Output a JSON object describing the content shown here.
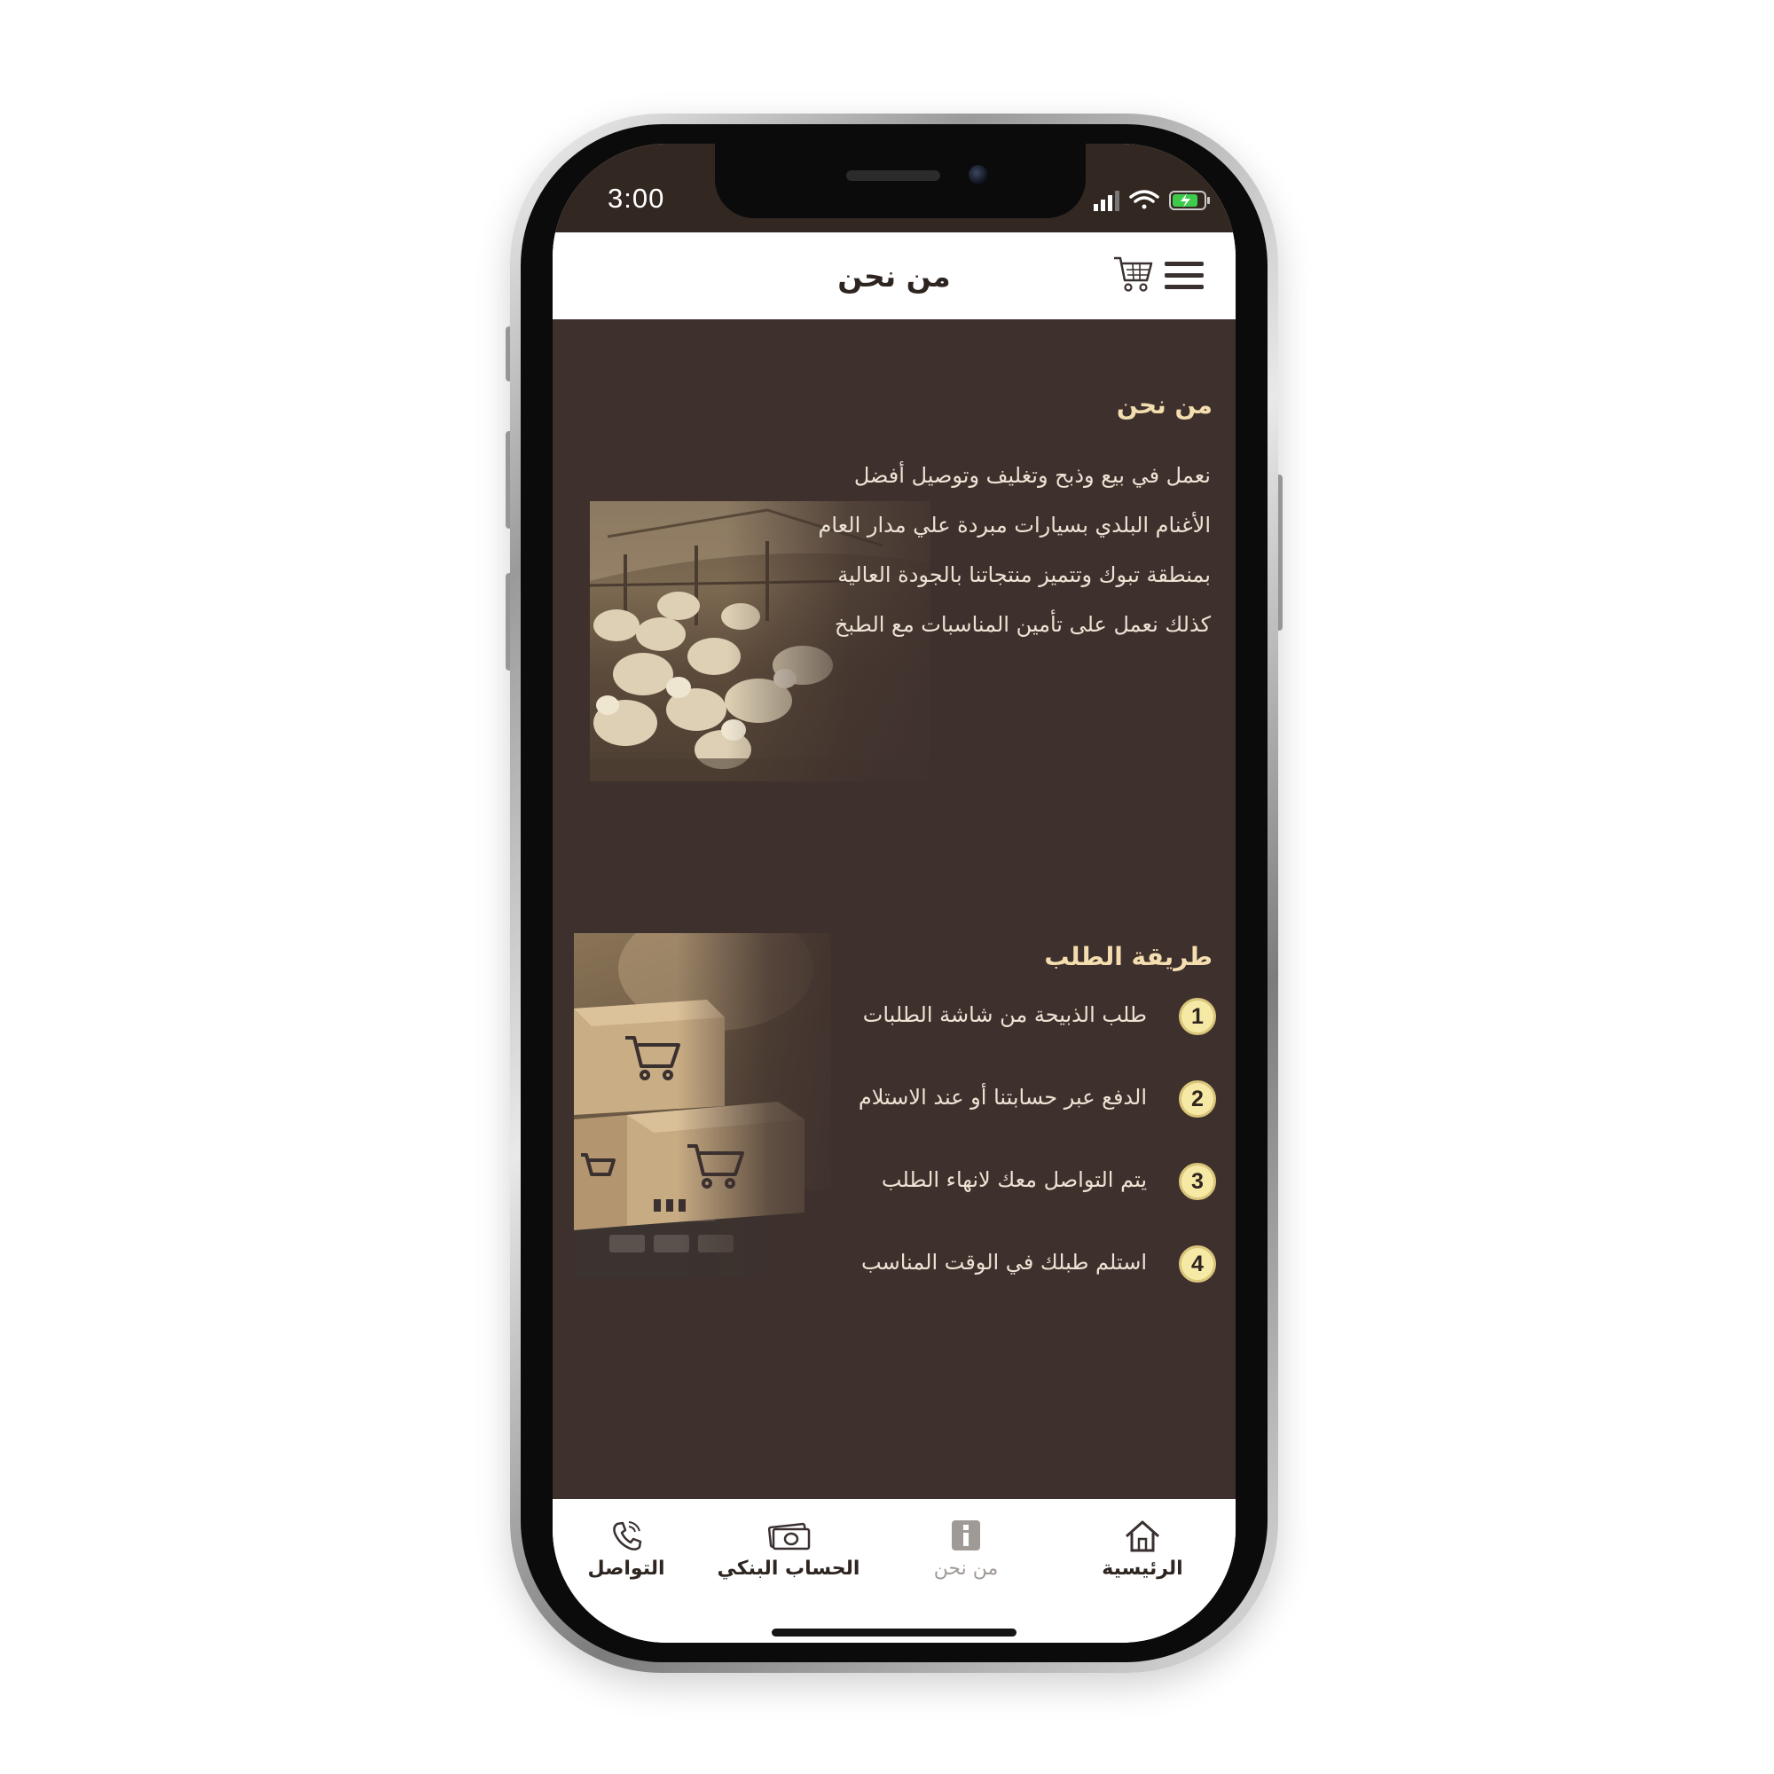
{
  "status_bar": {
    "time": "3:00"
  },
  "header": {
    "title": "من نحن",
    "menu_icon": "hamburger-menu-icon",
    "cart_icon": "shopping-cart-icon"
  },
  "about": {
    "title": "من نحن",
    "lines": [
      "نعمل في بيع وذبح وتغليف وتوصيل أفضل",
      "الأغنام البلدي بسيارات مبردة علي مدار العام",
      "بمنطقة تبوك وتتميز منتجاتنا بالجودة العالية",
      "كذلك نعمل على تأمين المناسبات مع الطبخ"
    ]
  },
  "order_method": {
    "title": "طريقة الطلب",
    "steps": [
      {
        "number": "1",
        "text": "طلب الذبيحة من شاشة الطلبات"
      },
      {
        "number": "2",
        "text": "الدفع عبر حسابتنا أو عند الاستلام"
      },
      {
        "number": "3",
        "text": "يتم التواصل معك لانهاء الطلب"
      },
      {
        "number": "4",
        "text": "استلم طبلك في الوقت المناسب"
      }
    ]
  },
  "bottom_nav": {
    "items": [
      {
        "label": "الرئيسية",
        "icon": "home-icon"
      },
      {
        "label": "من نحن",
        "icon": "info-icon"
      },
      {
        "label": "الحساب البنكي",
        "icon": "money-icon"
      },
      {
        "label": "التواصل",
        "icon": "phone-icon"
      }
    ],
    "active_index": 1
  },
  "colors": {
    "content_background": "#3e302c",
    "heading_accent": "#f4deb0",
    "step_badge": "#f6e9a5",
    "text": "#ede3d4"
  }
}
